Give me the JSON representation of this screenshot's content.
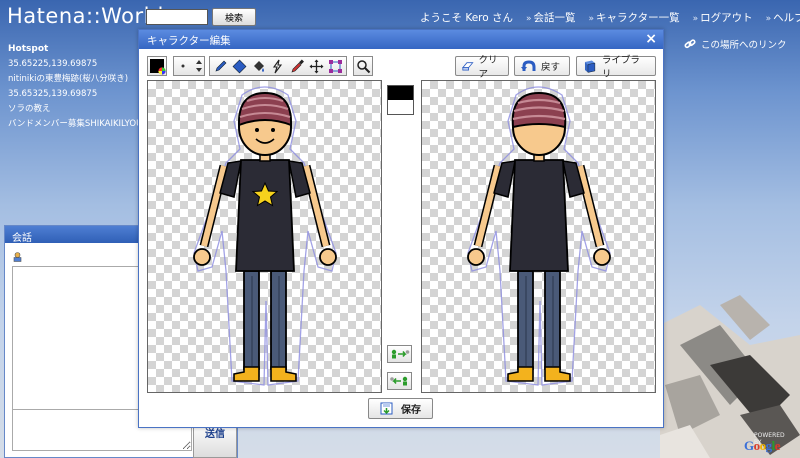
{
  "header": {
    "logo": "Hatena::World",
    "search_value": "",
    "search_button": "検索",
    "nav": [
      {
        "label": "ようこそ Kero さん"
      },
      {
        "label": "会話一覧"
      },
      {
        "label": "キャラクター一覧"
      },
      {
        "label": "ログアウト"
      },
      {
        "label": "ヘルプ"
      }
    ],
    "link_here": "この場所へのリンク"
  },
  "hotspot": {
    "title": "Hotspot",
    "items": [
      "35.65225,139.69875",
      "nitinikiの東豊梅跡(桜八分咲き)",
      "35.65325,139.69875",
      "ソラの教え",
      "バンドメンバー募集SHIKAIKILYOU"
    ]
  },
  "chat": {
    "title": "会話",
    "send_label": "送信",
    "input_value": ""
  },
  "dialog": {
    "title": "キャラクター編集",
    "close": "×",
    "buttons": {
      "clear": "クリア",
      "undo": "戻す",
      "library": "ライブラリ",
      "save": "保存"
    }
  },
  "colors": {
    "swatch_primary": "#000000",
    "swatch_secondary": "#ffffff",
    "shirt": "#2b2b35",
    "skin": "#f7c98d",
    "pants": "#4a5a78",
    "shoes": "#f3b21d",
    "hat": "#8c4050",
    "accent_blue": "#3566c3"
  },
  "map": {
    "powered_by": "POWERED BY",
    "google": "Google"
  }
}
